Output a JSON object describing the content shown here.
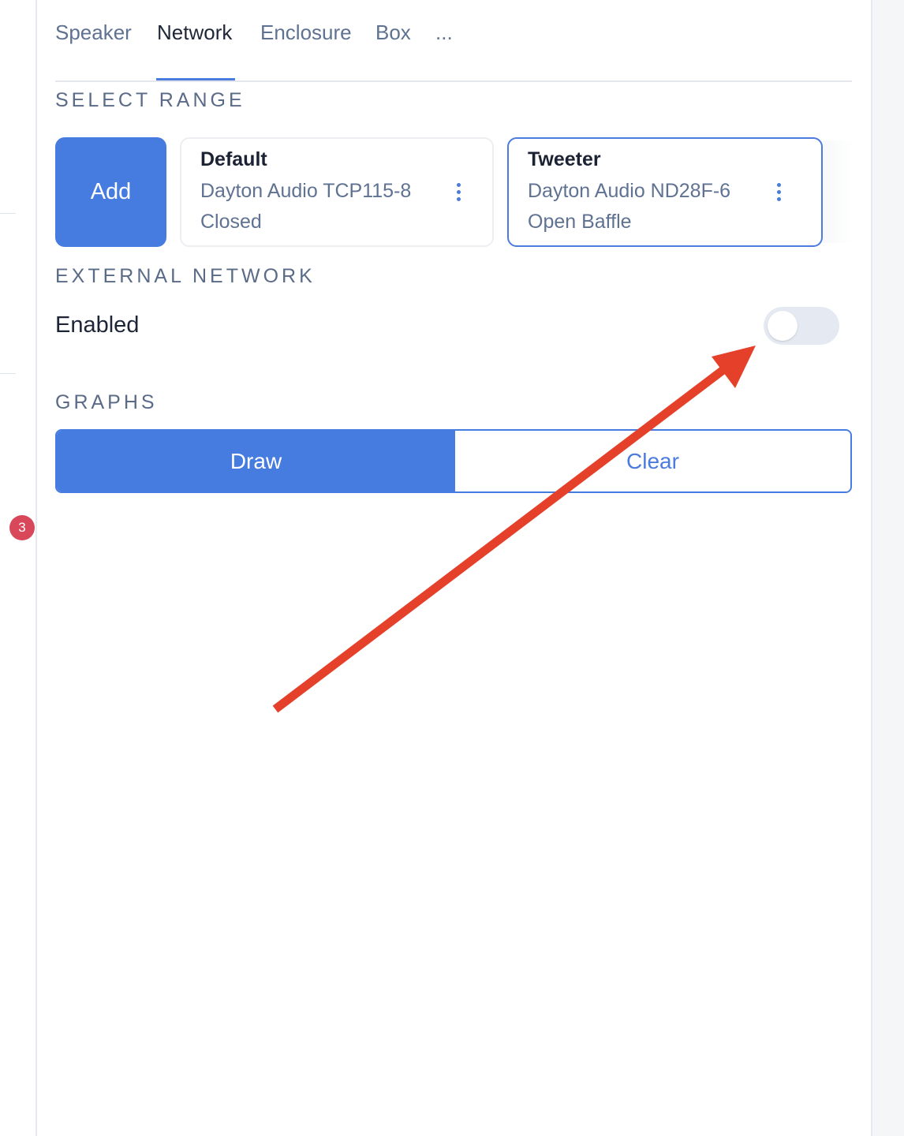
{
  "tabs": [
    {
      "label": "Speaker",
      "active": false
    },
    {
      "label": "Network",
      "active": true
    },
    {
      "label": "Enclosure",
      "active": false
    },
    {
      "label": "Box",
      "active": false
    },
    {
      "label": "...",
      "active": false
    }
  ],
  "select_range": {
    "title": "SELECT RANGE",
    "add_label": "Add",
    "cards": [
      {
        "name": "Default",
        "model": "Dayton Audio TCP115-8",
        "enclosure": "Closed",
        "selected": false
      },
      {
        "name": "Tweeter",
        "model": "Dayton Audio ND28F-6",
        "enclosure": "Open Baffle",
        "selected": true
      }
    ]
  },
  "external_network": {
    "title": "EXTERNAL NETWORK",
    "enabled_label": "Enabled",
    "enabled": false
  },
  "graphs": {
    "title": "GRAPHS",
    "draw_label": "Draw",
    "clear_label": "Clear"
  },
  "sidebar": {
    "badge_count": "3"
  },
  "colors": {
    "accent": "#467be0",
    "annotation_arrow": "#e5402a",
    "badge": "#d9485a"
  }
}
